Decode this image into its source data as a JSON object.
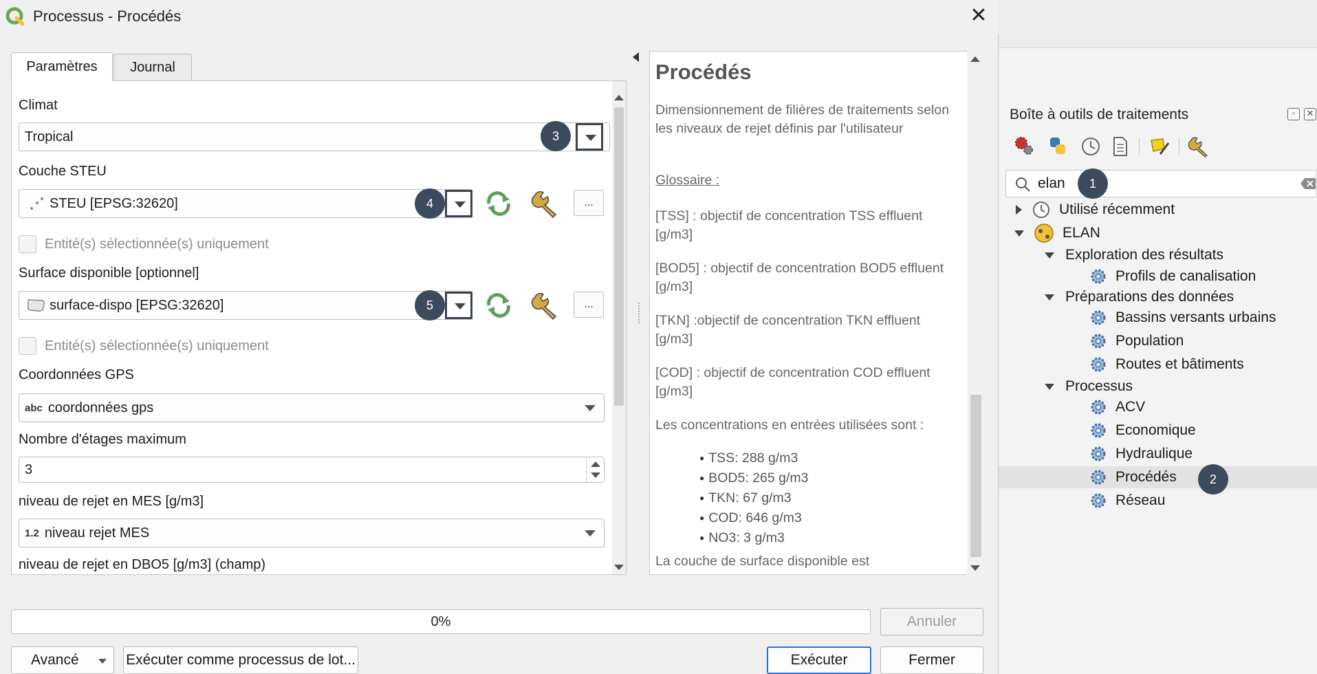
{
  "window": {
    "title": "Processus - Procédés",
    "close_symbol": "✕"
  },
  "tabs": [
    {
      "label": "Paramètres"
    },
    {
      "label": "Journal"
    }
  ],
  "params": {
    "climat": {
      "label": "Climat",
      "value": "Tropical",
      "badge": "3"
    },
    "steu": {
      "label": "Couche STEU",
      "value": "STEU [EPSG:32620]",
      "badge": "4",
      "more": "..."
    },
    "steu_selected_only": {
      "label": "Entité(s) sélectionnée(s) uniquement"
    },
    "surface": {
      "label": "Surface disponible [optionnel]",
      "value": "surface-dispo [EPSG:32620]",
      "badge": "5",
      "more": "..."
    },
    "surface_selected_only": {
      "label": "Entité(s) sélectionnée(s) uniquement"
    },
    "gps": {
      "label": "Coordonnées GPS",
      "prefix": "abc",
      "value": "coordonnées gps"
    },
    "etages": {
      "label": "Nombre d'étages maximum",
      "value": "3"
    },
    "mes": {
      "label": "niveau de rejet en MES [g/m3]",
      "prefix": "1.2",
      "value": "niveau rejet MES"
    },
    "dbo5": {
      "label": "niveau de rejet en DBO5 [g/m3] (champ)"
    }
  },
  "help": {
    "title": "Procédés",
    "intro": "Dimensionnement de filières de traitements selon les niveaux de rejet définis par l'utilisateur",
    "glossary_heading": "Glossaire :",
    "tss": "[TSS] : objectif de concentration TSS effluent [g/m3]",
    "bod5": "[BOD5] : objectif de concentration BOD5 effluent [g/m3]",
    "tkn": "[TKN] :objectif de concentration TKN effluent [g/m3]",
    "cod": "[COD] : objectif de concentration COD effluent [g/m3]",
    "conc_heading": "Les concentrations en entrées utilisées sont :",
    "concentrations": [
      "TSS: 288 g/m3",
      "BOD5: 265 g/m3",
      "TKN: 67 g/m3",
      "COD: 646 g/m3",
      "NO3: 3 g/m3"
    ],
    "surface_note": "La couche de surface disponible est"
  },
  "progress": {
    "value_text": "0%",
    "fraction": 0
  },
  "buttons": {
    "cancel": "Annuler",
    "advanced": "Avancé",
    "batch": "Exécuter comme processus de lot...",
    "run": "Exécuter",
    "close": "Fermer"
  },
  "toolbox": {
    "title": "Boîte à outils de traitements",
    "search_value": "elan",
    "search_badge": "1",
    "tree": {
      "recent": "Utilisé récemment",
      "elan": "ELAN",
      "exploration": "Exploration des résultats",
      "profils": "Profils de canalisation",
      "preparations": "Préparations des données",
      "bassins": "Bassins versants urbains",
      "population": "Population",
      "routes": "Routes et bâtiments",
      "processus": "Processus",
      "acv": "ACV",
      "economique": "Economique",
      "hydraulique": "Hydraulique",
      "procedes": "Procédés",
      "procedes_badge": "2",
      "reseau": "Réseau"
    }
  },
  "colors": {
    "badge": "#3b4a5c",
    "default_button_border": "#2d6fd0",
    "refresh_icon": "#5aa05a"
  }
}
